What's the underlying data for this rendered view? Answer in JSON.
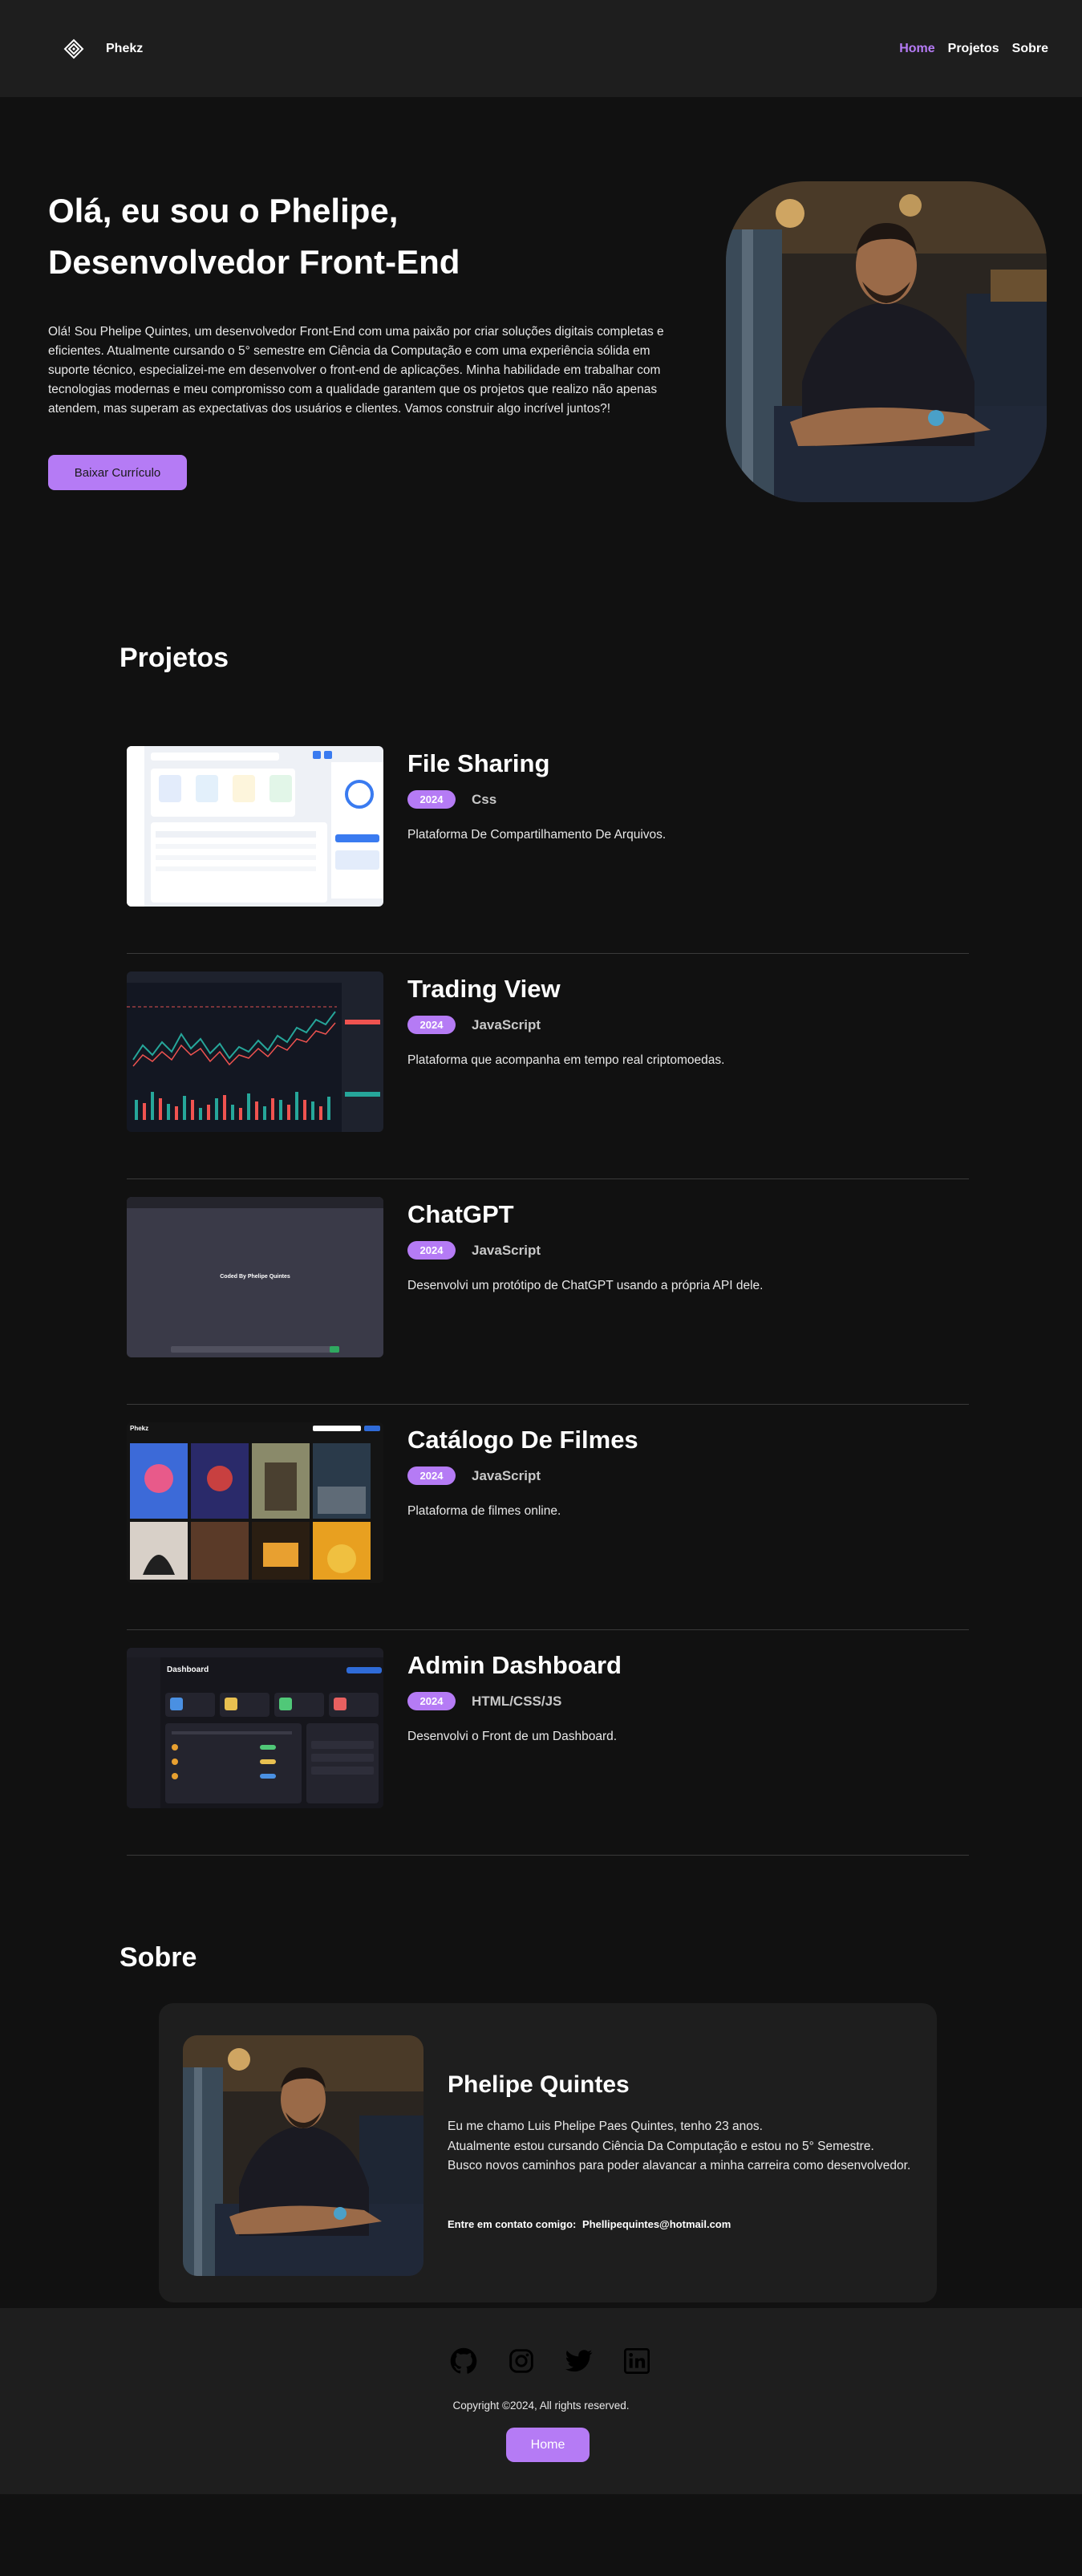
{
  "header": {
    "brand": "Phekz",
    "nav": [
      {
        "label": "Home",
        "active": true
      },
      {
        "label": "Projetos",
        "active": false
      },
      {
        "label": "Sobre",
        "active": false
      }
    ]
  },
  "hero": {
    "title_line1": "Olá, eu sou o Phelipe,",
    "title_line2": "Desenvolvedor Front-End",
    "text": "Olá! Sou Phelipe Quintes, um desenvolvedor Front-End com uma paixão por criar soluções digitais completas e eficientes. Atualmente cursando o 5° semestre em Ciência da Computação e com uma experiência sólida em suporte técnico, especializei-me em desenvolver o front-end de aplicações. Minha habilidade em trabalhar com tecnologias modernas e meu compromisso com a qualidade garantem que os projetos que realizo não apenas atendem, mas superam as expectativas dos usuários e clientes. Vamos construir algo incrível juntos?!",
    "cv_button": "Baixar Currículo"
  },
  "projects": {
    "title": "Projetos",
    "items": [
      {
        "title": "File Sharing",
        "year": "2024",
        "tech": "Css",
        "desc": "Plataforma De Compartilhamento De Arquivos."
      },
      {
        "title": "Trading View",
        "year": "2024",
        "tech": "JavaScript",
        "desc": "Plataforma que acompanha em tempo real criptomoedas."
      },
      {
        "title": "ChatGPT",
        "year": "2024",
        "tech": "JavaScript",
        "desc": "Desenvolvi um protótipo de ChatGPT usando a própria API dele."
      },
      {
        "title": "Catálogo De Filmes",
        "year": "2024",
        "tech": "JavaScript",
        "desc": "Plataforma de filmes online."
      },
      {
        "title": "Admin Dashboard",
        "year": "2024",
        "tech": "HTML/CSS/JS",
        "desc": "Desenvolvi o Front de um Dashboard."
      }
    ],
    "thumbs": {
      "chatgpt_caption": "Coded By Phelipe Quintes",
      "movies_brand": "Phekz",
      "dashboard_title": "Dashboard"
    }
  },
  "about": {
    "title": "Sobre",
    "name": "Phelipe Quintes",
    "line1": "Eu me chamo Luis Phelipe Paes Quintes, tenho 23 anos.",
    "line2": "Atualmente estou cursando Ciência Da Computação e estou no 5° Semestre.",
    "line3": "Busco novos caminhos para poder alavancar a minha carreira como desenvolvedor.",
    "contact_label": "Entre em contato comigo:",
    "contact_email": "Phellipequintes@hotmail.com"
  },
  "footer": {
    "social_icons": [
      "github-icon",
      "instagram-icon",
      "twitter-icon",
      "linkedin-icon"
    ],
    "copyright": "Copyright ©2024, All rights reserved.",
    "home_button": "Home"
  },
  "colors": {
    "accent": "#b57bf5",
    "background": "#111111",
    "surface": "#1e1e1e"
  }
}
